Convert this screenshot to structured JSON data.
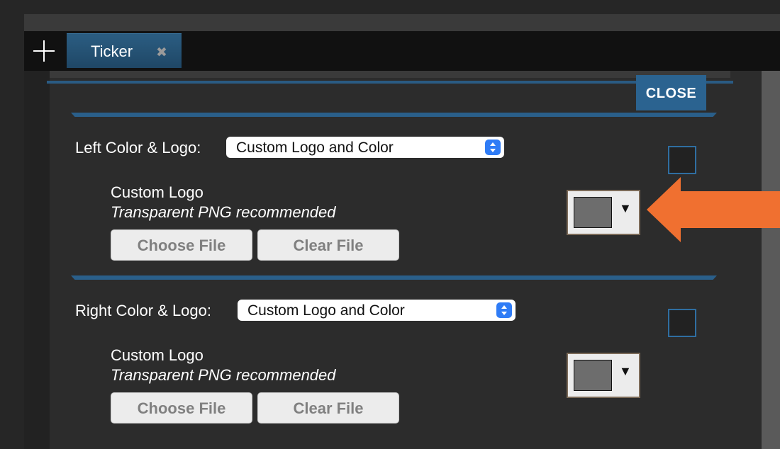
{
  "tabs": [
    {
      "label": "Ticker",
      "close_icon": "close-icon"
    }
  ],
  "new_tab_icon": "plus-icon",
  "dialog": {
    "close_label": "CLOSE",
    "sections": [
      {
        "label": "Left Color & Logo:",
        "select_value": "Custom Logo and Color",
        "logo_label": "Custom Logo",
        "logo_hint": "Transparent PNG recommended",
        "choose_label": "Choose File",
        "clear_label": "Clear File",
        "checkbox_checked": false,
        "swatch_color": "#6d6d6d"
      },
      {
        "label": "Right Color & Logo:",
        "select_value": "Custom Logo and Color",
        "logo_label": "Custom Logo",
        "logo_hint": "Transparent PNG recommended",
        "choose_label": "Choose File",
        "clear_label": "Clear File",
        "checkbox_checked": false,
        "swatch_color": "#6d6d6d"
      }
    ]
  },
  "colors": {
    "accent": "#2b6390",
    "annotation_arrow": "#f07030"
  },
  "picker_arrow_glyph": "▼",
  "tab_close_glyph": "✖"
}
